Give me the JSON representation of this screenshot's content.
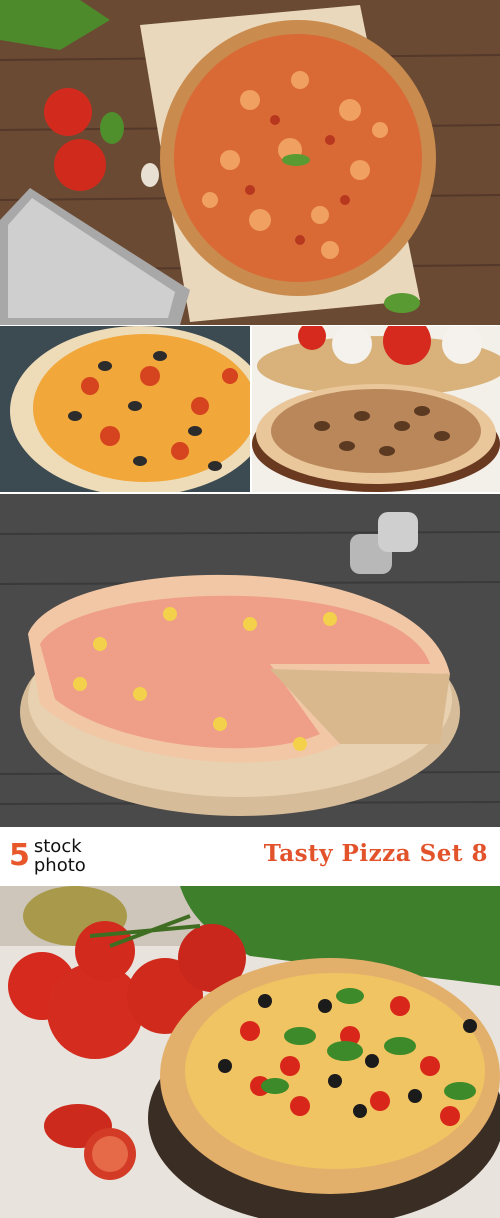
{
  "banner": {
    "logo_number": "5",
    "logo_word_1": "stock",
    "logo_word_2": "photo",
    "title": "Tasty Pizza Set 8"
  },
  "colors": {
    "accent": "#e2532c",
    "logo_number": "#e8572a",
    "text": "#111111"
  }
}
